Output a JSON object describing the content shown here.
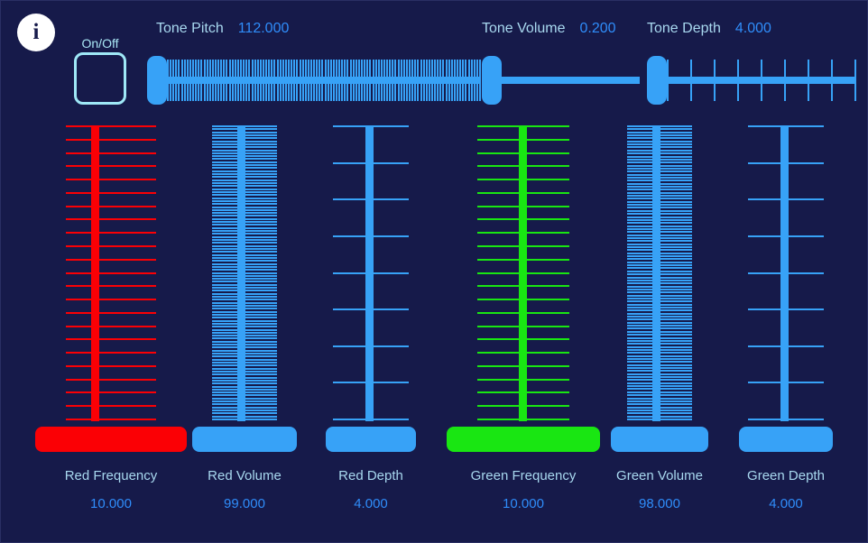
{
  "window": {
    "background_color": "#161a4a",
    "accent_blue": "#37a2f7",
    "label_color": "#a8d8ef",
    "value_color": "#2f8dfa",
    "red_color": "#fb0005",
    "green_color": "#19e612"
  },
  "info": {
    "icon": "info-icon",
    "glyph": "i"
  },
  "onoff": {
    "label": "On/Off",
    "checked": false
  },
  "top_sliders": [
    {
      "id": "tone-pitch",
      "label": "Tone Pitch",
      "value": "112.000",
      "numeric_value": 112.0,
      "tick_count": 112,
      "thumb_position": "left",
      "color": "#37a2f7"
    },
    {
      "id": "tone-volume",
      "label": "Tone Volume",
      "value": "0.200",
      "numeric_value": 0.2,
      "tick_count": 0,
      "thumb_position": "left",
      "color": "#37a2f7"
    },
    {
      "id": "tone-depth",
      "label": "Tone Depth",
      "value": "4.000",
      "numeric_value": 4.0,
      "tick_count": 9,
      "thumb_position": "left",
      "color": "#37a2f7"
    }
  ],
  "vertical_sliders": [
    {
      "id": "red-frequency",
      "label": "Red Frequency",
      "value": "10.000",
      "numeric_value": 10.0,
      "tick_count": 23,
      "thumb_position": "bottom",
      "color": "#fb0005"
    },
    {
      "id": "red-volume",
      "label": "Red Volume",
      "value": "99.000",
      "numeric_value": 99.0,
      "tick_count": 99,
      "thumb_position": "bottom",
      "color": "#37a2f7"
    },
    {
      "id": "red-depth",
      "label": "Red Depth",
      "value": "4.000",
      "numeric_value": 4.0,
      "tick_count": 9,
      "thumb_position": "bottom",
      "color": "#37a2f7"
    },
    {
      "id": "green-frequency",
      "label": "Green Frequency",
      "value": "10.000",
      "numeric_value": 10.0,
      "tick_count": 23,
      "thumb_position": "bottom",
      "color": "#19e612"
    },
    {
      "id": "green-volume",
      "label": "Green Volume",
      "value": "98.000",
      "numeric_value": 98.0,
      "tick_count": 98,
      "thumb_position": "bottom",
      "color": "#37a2f7"
    },
    {
      "id": "green-depth",
      "label": "Green Depth",
      "value": "4.000",
      "numeric_value": 4.0,
      "tick_count": 9,
      "thumb_position": "bottom",
      "color": "#37a2f7"
    }
  ]
}
